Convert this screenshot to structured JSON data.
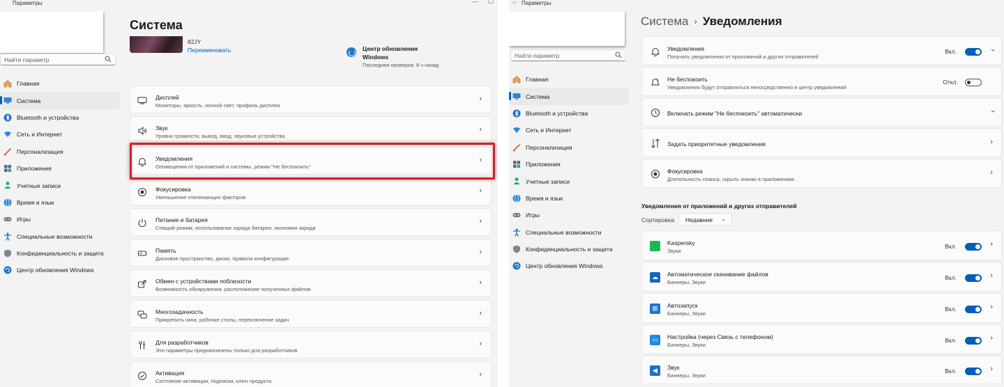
{
  "left": {
    "titlebar": {
      "title": "Параметры",
      "min": "—",
      "max": "☐"
    },
    "search": {
      "placeholder": "Найти параметр"
    },
    "nav": [
      {
        "label": "Главная",
        "icon": "home-icon"
      },
      {
        "label": "Система",
        "icon": "system-icon",
        "active": true
      },
      {
        "label": "Bluetooth и устройства",
        "icon": "bluetooth-icon"
      },
      {
        "label": "Сеть и Интернет",
        "icon": "network-icon"
      },
      {
        "label": "Персонализация",
        "icon": "brush-icon"
      },
      {
        "label": "Приложения",
        "icon": "apps-icon"
      },
      {
        "label": "Учетные записи",
        "icon": "accounts-icon"
      },
      {
        "label": "Время и язык",
        "icon": "globe-icon"
      },
      {
        "label": "Игры",
        "icon": "gamepad-icon"
      },
      {
        "label": "Специальные возможности",
        "icon": "accessibility-icon"
      },
      {
        "label": "Конфиденциальность и защита",
        "icon": "shield-icon"
      },
      {
        "label": "Центр обновления Windows",
        "icon": "update-icon"
      }
    ],
    "page_title": "Система",
    "device": {
      "name": "82JY",
      "rename": "Переименовать"
    },
    "update": {
      "title": "Центр обновления Windows",
      "sub": "Последняя проверка: 8 ч назад"
    },
    "cards": [
      {
        "title": "Дисплей",
        "sub": "Мониторы, яркость, ночной свет, профиль дисплея",
        "icon": "display-icon"
      },
      {
        "title": "Звук",
        "sub": "Уровни громкости, вывод, ввод, звуковые устройства",
        "icon": "speaker-icon"
      },
      {
        "title": "Уведомления",
        "sub": "Оповещения от приложений и системы, режим \"Не беспокоить\"",
        "icon": "bell-icon"
      },
      {
        "title": "Фокусировка",
        "sub": "Уменьшение отвлекающих факторов",
        "icon": "focus-icon"
      },
      {
        "title": "Питание и батарея",
        "sub": "Спящий режим, использование заряда батареи, экономия заряда",
        "icon": "power-icon"
      },
      {
        "title": "Память",
        "sub": "Дисковое пространство, диски, правила конфигурации",
        "icon": "storage-icon"
      },
      {
        "title": "Обмен с устройствами поблизости",
        "sub": "Возможность обнаружения, расположение полученных файлов",
        "icon": "share-icon"
      },
      {
        "title": "Многозадачность",
        "sub": "Прикрепить окна, рабочие столы, переключение задач",
        "icon": "multitask-icon"
      },
      {
        "title": "Для разработчиков",
        "sub": "Эти параметры предназначены только для разработчиков",
        "icon": "developer-icon"
      },
      {
        "title": "Активация",
        "sub": "Состояние активации, подписки, ключ продукта",
        "icon": "activation-icon"
      }
    ]
  },
  "right": {
    "titlebar": {
      "title": "Параметры"
    },
    "search": {
      "placeholder": "Найти параметр"
    },
    "nav": [
      {
        "label": "Главная"
      },
      {
        "label": "Система",
        "active": true
      },
      {
        "label": "Bluetooth и устройства"
      },
      {
        "label": "Сеть и Интернет"
      },
      {
        "label": "Персонализация"
      },
      {
        "label": "Приложения"
      },
      {
        "label": "Учетные записи"
      },
      {
        "label": "Время и язык"
      },
      {
        "label": "Игры"
      },
      {
        "label": "Специальные возможности"
      },
      {
        "label": "Конфиденциальность и защита"
      },
      {
        "label": "Центр обновления Windows"
      }
    ],
    "breadcrumb": {
      "parent": "Система",
      "sep": "›",
      "current": "Уведомления"
    },
    "settings": [
      {
        "title": "Уведомления",
        "sub": "Получать уведомления от приложений и других отправителей",
        "state": "Вкл.",
        "on": true
      },
      {
        "title": "Не беспокоить",
        "sub": "Уведомления будут отправляться непосредственно в центр уведомлений",
        "state": "Откл.",
        "on": false
      },
      {
        "title": "Включать режим \"Не беспокоить\" автоматически"
      },
      {
        "title": "Задать приоритетные уведомления"
      },
      {
        "title": "Фокусировка",
        "sub": "Длительность сеанса, скрыть значки в приложениях"
      }
    ],
    "section_title": "Уведомления от приложений и других отправителей",
    "sort": {
      "label": "Сортировка:",
      "value": "Недавние"
    },
    "apps": [
      {
        "name": "Kaspersky",
        "sub": "Звуки",
        "state": "Вкл.",
        "color": "#1db954"
      },
      {
        "name": "Автоматическое скачивание файлов",
        "sub": "Баннеры, Звуки",
        "state": "Вкл.",
        "color": "#1565c0"
      },
      {
        "name": "Автозапуск",
        "sub": "Баннеры, Звуки",
        "state": "Вкл.",
        "color": "#1976d2"
      },
      {
        "name": "Настройка (через Связь с телефоном)",
        "sub": "Баннеры, Звуки",
        "state": "Вкл.",
        "color": "#1e88e5"
      },
      {
        "name": "Звук",
        "sub": "Баннеры, Звуки",
        "state": "Вкл.",
        "color": "#1e6fd0"
      }
    ]
  }
}
